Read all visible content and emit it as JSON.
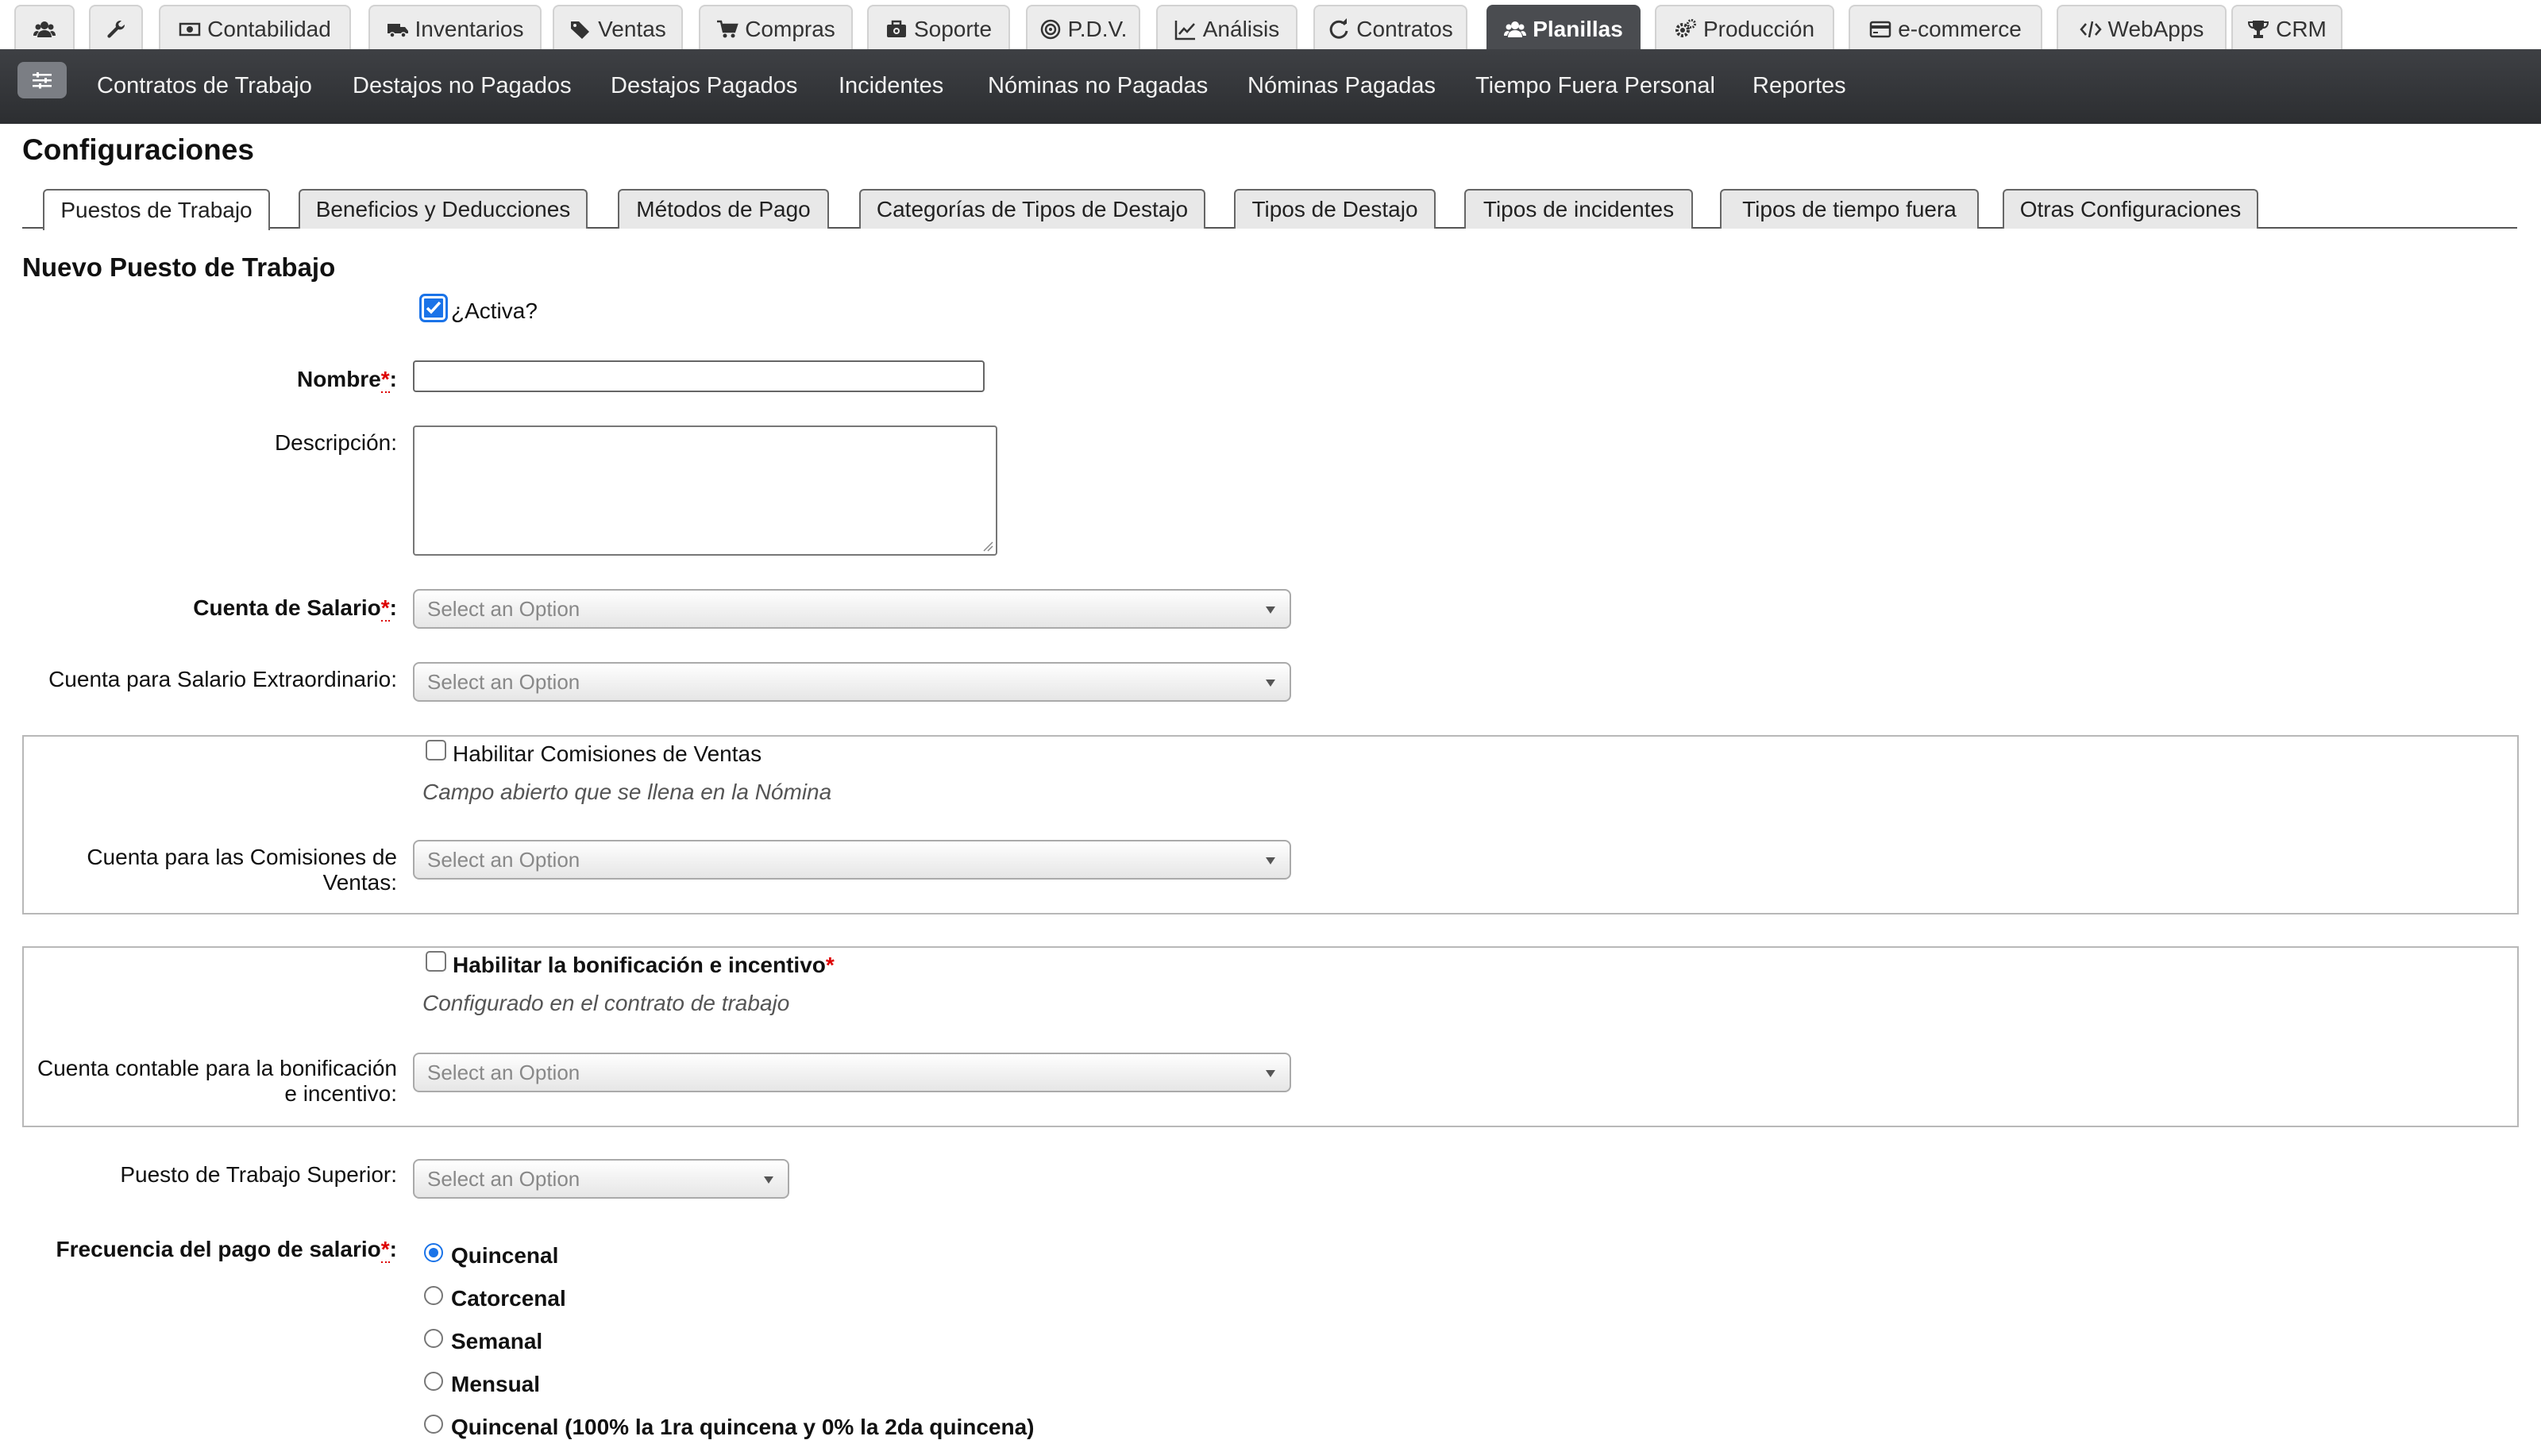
{
  "top_tabs": [
    {
      "label": "",
      "icon": "users-icon"
    },
    {
      "label": "",
      "icon": "wrench-icon"
    },
    {
      "label": "Contabilidad",
      "icon": "money-icon"
    },
    {
      "label": "Inventarios",
      "icon": "truck-icon"
    },
    {
      "label": "Ventas",
      "icon": "tags-icon"
    },
    {
      "label": "Compras",
      "icon": "cart-icon"
    },
    {
      "label": "Soporte",
      "icon": "briefcase-medical-icon"
    },
    {
      "label": "P.D.V.",
      "icon": "target-icon"
    },
    {
      "label": "Análisis",
      "icon": "line-chart-icon"
    },
    {
      "label": "Contratos",
      "icon": "refresh-icon"
    },
    {
      "label": "Planillas",
      "icon": "users-icon",
      "active": true
    },
    {
      "label": "Producción",
      "icon": "gears-icon"
    },
    {
      "label": "e-commerce",
      "icon": "credit-card-icon"
    },
    {
      "label": "WebApps",
      "icon": "code-icon"
    },
    {
      "label": "CRM",
      "icon": "trophy-icon"
    }
  ],
  "subnav": {
    "menu_icon": "sliders-icon",
    "items": [
      "Contratos de Trabajo",
      "Destajos no Pagados",
      "Destajos Pagados",
      "Incidentes",
      "Nóminas no Pagadas",
      "Nóminas Pagadas",
      "Tiempo Fuera Personal",
      "Reportes"
    ]
  },
  "page_title": "Configuraciones",
  "config_tabs": [
    {
      "label": "Puestos de Trabajo",
      "active": true
    },
    {
      "label": "Beneficios y Deducciones"
    },
    {
      "label": "Métodos de Pago"
    },
    {
      "label": "Categorías de Tipos de Destajo"
    },
    {
      "label": "Tipos de Destajo"
    },
    {
      "label": "Tipos de incidentes"
    },
    {
      "label": "Tipos de tiempo fuera"
    },
    {
      "label": "Otras Configuraciones"
    }
  ],
  "form": {
    "section_title": "Nuevo Puesto de Trabajo",
    "active_label": "¿Activa?",
    "active_checked": true,
    "nombre_label": "Nombre",
    "nombre_value": "",
    "descripcion_label": "Descripción:",
    "descripcion_value": "",
    "required_mark": "*",
    "colon": ":",
    "cuenta_salario_label": "Cuenta de Salario",
    "cuenta_extra_label": "Cuenta para Salario Extraordinario:",
    "select_placeholder": "Select an Option",
    "comisiones": {
      "checkbox_label": "Habilitar Comisiones de Ventas",
      "checked": false,
      "help": "Campo abierto que se llena en la Nómina",
      "cuenta_label_line1": "Cuenta para las Comisiones de",
      "cuenta_label_line2": "Ventas:"
    },
    "bonificacion": {
      "checkbox_label": "Habilitar la bonificación e incentivo",
      "checked": false,
      "help": "Configurado en el contrato de trabajo",
      "cuenta_label_line1": "Cuenta contable para la bonificación",
      "cuenta_label_line2": "e incentivo:"
    },
    "puesto_superior_label": "Puesto de Trabajo Superior:",
    "frecuencia_label": "Frecuencia del pago de salario",
    "frecuencia_options": [
      {
        "label": "Quincenal",
        "checked": true
      },
      {
        "label": "Catorcenal",
        "checked": false
      },
      {
        "label": "Semanal",
        "checked": false
      },
      {
        "label": "Mensual",
        "checked": false
      },
      {
        "label": "Quincenal (100% la 1ra quincena y 0% la 2da quincena)",
        "checked": false
      }
    ]
  },
  "colors": {
    "active_tab_bg": "#4a4c50",
    "subnav_bg": "#2c2e31",
    "accent_blue": "#1a73e8",
    "required_red": "#dd0000"
  }
}
